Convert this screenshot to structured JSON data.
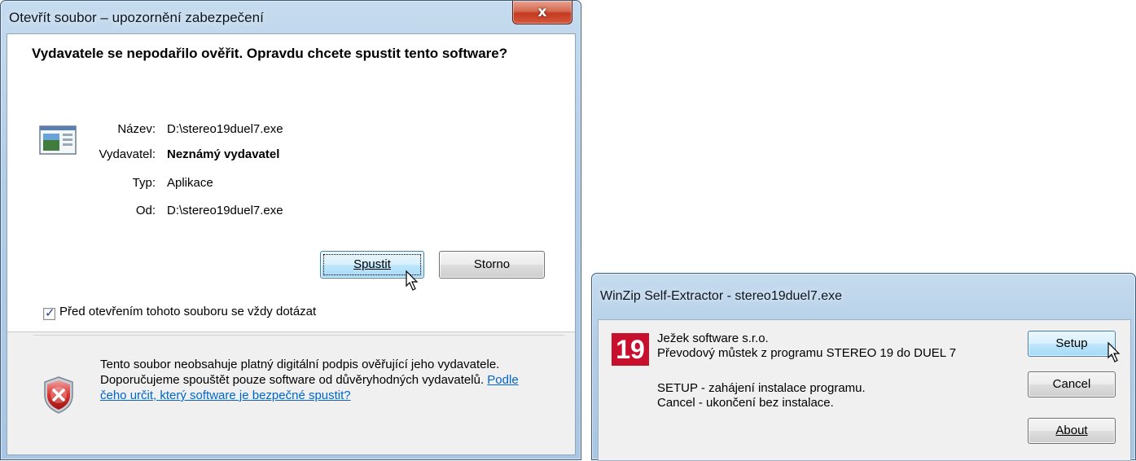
{
  "dialog1": {
    "title": "Otevřít soubor – upozornění zabezpečení",
    "close_label": "x",
    "heading": "Vydavatele se nepodařilo ověřit. Opravdu chcete spustit tento software?",
    "fields": [
      {
        "label": "Název:",
        "value": "D:\\stereo19duel7.exe",
        "bold": false
      },
      {
        "label": "Vydavatel:",
        "value": "Neznámý vydavatel",
        "bold": true
      },
      {
        "label": "Typ:",
        "value": "Aplikace",
        "bold": false
      },
      {
        "label": "Od:",
        "value": "D:\\stereo19duel7.exe",
        "bold": false
      }
    ],
    "run_button": "Spustit",
    "cancel_button": "Storno",
    "checkbox_label": "Před otevřením tohoto souboru se vždy dotázat",
    "checkbox_checked": true,
    "warning_text": "Tento soubor neobsahuje platný digitální podpis ověřující jeho vydavatele. Doporučujeme spouštět pouze software od důvěryhodných vydavatelů.",
    "warning_link": "Podle čeho určit, který software je bezpečné spustit?"
  },
  "dialog2": {
    "title": "WinZip Self-Extractor - stereo19duel7.exe",
    "logo_text": "19",
    "company": "Ježek software s.r.o.",
    "description": "Převodový můstek z programu STEREO 19 do DUEL 7",
    "line_setup": "SETUP - zahájení instalace programu.",
    "line_cancel": "Cancel - ukončení bez instalace.",
    "setup_button": "Setup",
    "cancel_button": "Cancel",
    "about_button": "About"
  },
  "colors": {
    "title_bar": "#b3cde6",
    "close_red": "#c43a22",
    "link": "#0066cc",
    "logo_red": "#c8102e",
    "default_button": "#bee6fd"
  },
  "icons": [
    "application-icon",
    "shield-error-icon",
    "mouse-cursor-icon",
    "checkmark-icon"
  ]
}
